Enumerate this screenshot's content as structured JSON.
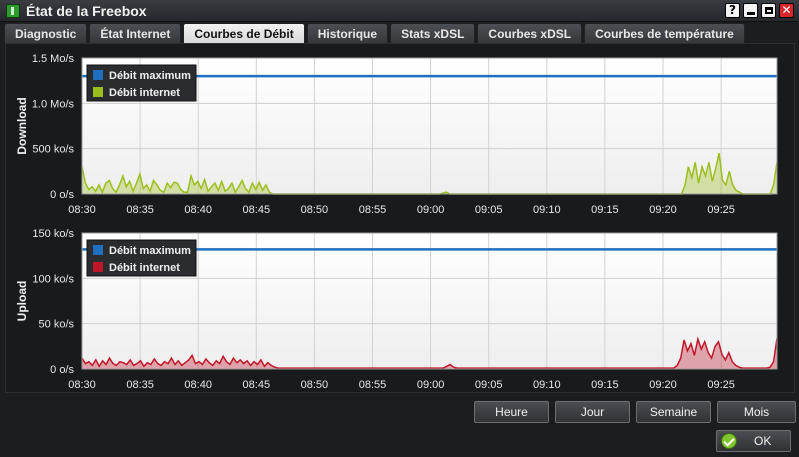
{
  "window": {
    "title": "État de la Freebox",
    "help_label": "?"
  },
  "tabs": [
    {
      "label": "Diagnostic",
      "active": false
    },
    {
      "label": "État Internet",
      "active": false
    },
    {
      "label": "Courbes de Débit",
      "active": true
    },
    {
      "label": "Historique",
      "active": false
    },
    {
      "label": "Stats xDSL",
      "active": false
    },
    {
      "label": "Courbes xDSL",
      "active": false
    },
    {
      "label": "Courbes de température",
      "active": false
    }
  ],
  "period_buttons": [
    "Heure",
    "Jour",
    "Semaine",
    "Mois"
  ],
  "ok_label": "OK",
  "colors": {
    "max": "#1f6fbf",
    "download": "#9bbf1c",
    "upload": "#c0162a"
  },
  "chart_data": [
    {
      "type": "area",
      "ylabel": "Download",
      "x": [
        "08:30",
        "08:35",
        "08:40",
        "08:45",
        "08:50",
        "08:55",
        "09:00",
        "09:05",
        "09:10",
        "09:15",
        "09:20",
        "09:25"
      ],
      "y_ticks": [
        "0 o/s",
        "500 ko/s",
        "1.0 Mo/s",
        "1.5 Mo/s"
      ],
      "ylim": [
        0,
        1.5
      ],
      "unit": "Mo/s",
      "grid": true,
      "legend_position": "top-left",
      "series": [
        {
          "name": "Débit maximum",
          "color": "#1f6fbf",
          "kind": "line",
          "values": [
            1.3,
            1.3
          ]
        },
        {
          "name": "Débit internet",
          "color": "#9bbf1c",
          "kind": "area",
          "values": [
            0.3,
            0.12,
            0.05,
            0.08,
            0.03,
            0.1,
            0.02,
            0.12,
            0.15,
            0.06,
            0.02,
            0.1,
            0.2,
            0.08,
            0.14,
            0.03,
            0.12,
            0.22,
            0.06,
            0.1,
            0.03,
            0.15,
            0.1,
            0.04,
            0.02,
            0.12,
            0.07,
            0.13,
            0.12,
            0.05,
            0.02,
            0.02,
            0.2,
            0.1,
            0.14,
            0.06,
            0.16,
            0.03,
            0.08,
            0.12,
            0.04,
            0.14,
            0.03,
            0.06,
            0.12,
            0.02,
            0.08,
            0.15,
            0.06,
            0.02,
            0.12,
            0.05,
            0.13,
            0.04,
            0.1,
            0.02,
            0,
            0,
            0,
            0,
            0,
            0,
            0,
            0,
            0,
            0,
            0,
            0,
            0,
            0,
            0,
            0,
            0,
            0,
            0,
            0,
            0,
            0,
            0,
            0,
            0,
            0,
            0,
            0,
            0,
            0,
            0,
            0,
            0,
            0,
            0,
            0,
            0,
            0,
            0,
            0,
            0,
            0,
            0,
            0,
            0,
            0,
            0,
            0,
            0,
            0,
            0.01,
            0.02,
            0,
            0,
            0,
            0,
            0,
            0,
            0,
            0,
            0,
            0,
            0,
            0,
            0,
            0,
            0,
            0,
            0,
            0,
            0,
            0,
            0,
            0,
            0,
            0,
            0,
            0,
            0,
            0,
            0,
            0,
            0,
            0,
            0,
            0,
            0,
            0,
            0,
            0,
            0,
            0,
            0,
            0,
            0,
            0,
            0,
            0,
            0,
            0,
            0,
            0,
            0,
            0,
            0,
            0,
            0,
            0,
            0,
            0,
            0,
            0,
            0,
            0,
            0,
            0,
            0,
            0,
            0,
            0,
            0,
            0.1,
            0.3,
            0.18,
            0.35,
            0.12,
            0.3,
            0.2,
            0.35,
            0.14,
            0.28,
            0.45,
            0.15,
            0.1,
            0.25,
            0.1,
            0.04,
            0.02,
            0,
            0,
            0,
            0,
            0,
            0,
            0,
            0,
            0,
            0.1,
            0.35
          ]
        }
      ]
    },
    {
      "type": "area",
      "ylabel": "Upload",
      "x": [
        "08:30",
        "08:35",
        "08:40",
        "08:45",
        "08:50",
        "08:55",
        "09:00",
        "09:05",
        "09:10",
        "09:15",
        "09:20",
        "09:25"
      ],
      "y_ticks": [
        "0 o/s",
        "50 ko/s",
        "100 ko/s",
        "150 ko/s"
      ],
      "ylim": [
        0,
        150
      ],
      "unit": "ko/s",
      "grid": true,
      "legend_position": "top-left",
      "series": [
        {
          "name": "Débit maximum",
          "color": "#1f6fbf",
          "kind": "line",
          "values": [
            132,
            132
          ]
        },
        {
          "name": "Débit internet",
          "color": "#c0162a",
          "kind": "area",
          "values": [
            12,
            6,
            8,
            4,
            10,
            3,
            9,
            5,
            12,
            6,
            4,
            8,
            7,
            5,
            10,
            4,
            6,
            9,
            3,
            7,
            5,
            11,
            6,
            4,
            8,
            6,
            12,
            5,
            9,
            4,
            7,
            10,
            15,
            6,
            8,
            5,
            11,
            7,
            4,
            9,
            6,
            14,
            8,
            5,
            12,
            7,
            10,
            6,
            9,
            4,
            8,
            5,
            10,
            3,
            7,
            4,
            2,
            1,
            1,
            1,
            1,
            1,
            1,
            1,
            1,
            1,
            1,
            1,
            1,
            1,
            1,
            1,
            1,
            1,
            1,
            1,
            1,
            1,
            1,
            1,
            1,
            1,
            1,
            1,
            1,
            1,
            1,
            1,
            1,
            1,
            1,
            1,
            1,
            1,
            1,
            1,
            1,
            1,
            1,
            1,
            1,
            1,
            1,
            1,
            1,
            1,
            3,
            5,
            2,
            1,
            1,
            1,
            1,
            1,
            1,
            1,
            1,
            1,
            1,
            1,
            1,
            1,
            1,
            1,
            1,
            1,
            1,
            1,
            1,
            1,
            1,
            1,
            1,
            1,
            1,
            1,
            1,
            1,
            1,
            1,
            1,
            1,
            1,
            1,
            1,
            1,
            1,
            1,
            1,
            1,
            1,
            1,
            1,
            1,
            1,
            1,
            1,
            1,
            1,
            1,
            1,
            1,
            1,
            1,
            1,
            1,
            1,
            1,
            1,
            1,
            1,
            1,
            1,
            4,
            12,
            32,
            20,
            28,
            15,
            33,
            22,
            30,
            18,
            12,
            25,
            30,
            16,
            10,
            18,
            8,
            4,
            2,
            1,
            1,
            1,
            1,
            1,
            1,
            1,
            1,
            2,
            8,
            34
          ]
        }
      ]
    }
  ]
}
